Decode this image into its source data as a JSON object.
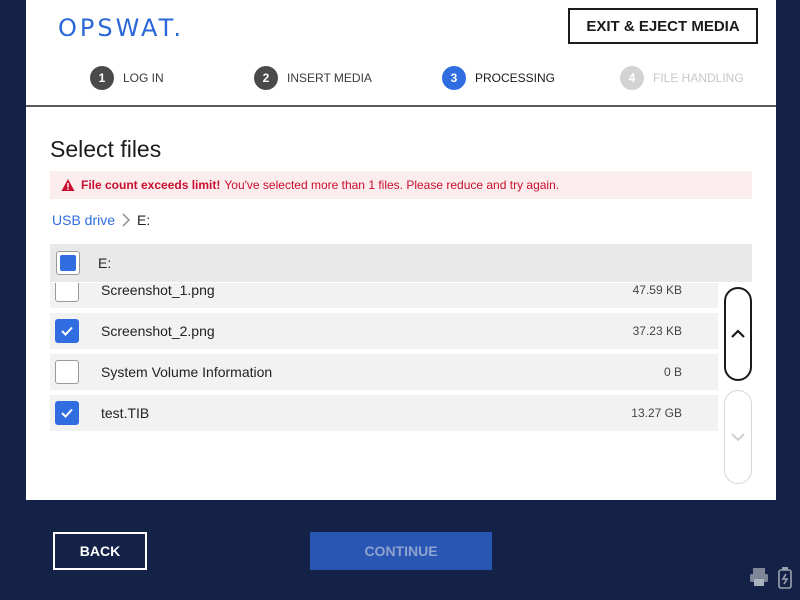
{
  "app": {
    "logo": "OPSWAT.",
    "exit_label": "EXIT & EJECT MEDIA"
  },
  "steps": [
    {
      "num": "1",
      "label": "LOG IN",
      "state": "done"
    },
    {
      "num": "2",
      "label": "INSERT MEDIA",
      "state": "done"
    },
    {
      "num": "3",
      "label": "PROCESSING",
      "state": "active"
    },
    {
      "num": "4",
      "label": "FILE HANDLING",
      "state": "pending"
    }
  ],
  "main": {
    "title": "Select files",
    "alert": {
      "bold": "File count exceeds limit!",
      "message": "You've selected more than 1 files. Please reduce and try again."
    },
    "breadcrumb": {
      "root": "USB drive",
      "current": "E:"
    },
    "header_label": "E:",
    "files": [
      {
        "name": "Screenshot_1.png",
        "size": "47.59 KB",
        "checked": false
      },
      {
        "name": "Screenshot_2.png",
        "size": "37.23 KB",
        "checked": true
      },
      {
        "name": "System Volume Information",
        "size": "0 B",
        "checked": false
      },
      {
        "name": "test.TIB",
        "size": "13.27 GB",
        "checked": true
      }
    ]
  },
  "footer": {
    "back_label": "BACK",
    "continue_label": "CONTINUE"
  },
  "colors": {
    "background": "#142248",
    "accent": "#2f6de1",
    "error": "#c8102e",
    "continue_disabled": "#2a56b3"
  }
}
